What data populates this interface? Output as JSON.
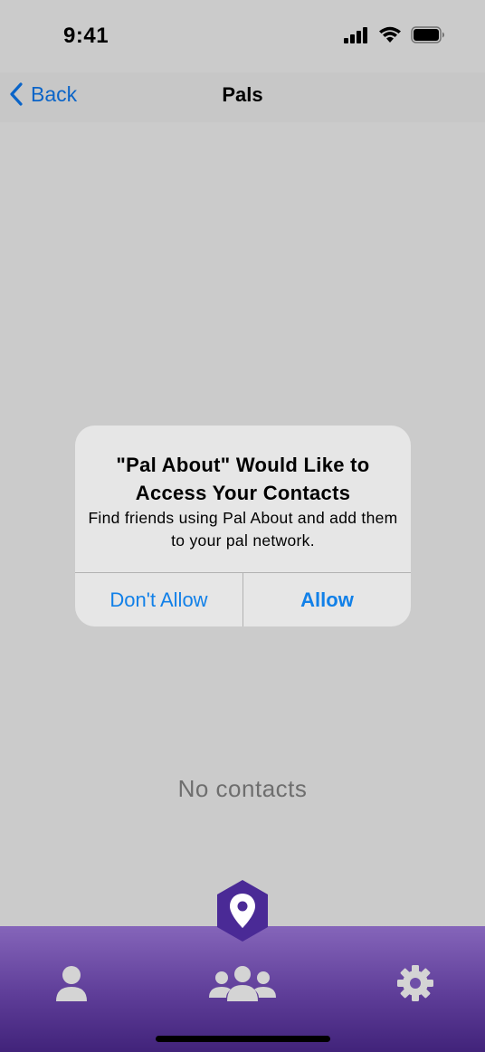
{
  "status_bar": {
    "time": "9:41"
  },
  "nav": {
    "back_label": "Back",
    "title": "Pals"
  },
  "main": {
    "empty_text": "No contacts"
  },
  "alert": {
    "title": "\"Pal About\" Would Like to Access Your Contacts",
    "message": "Find friends using Pal About and add them to your pal network.",
    "deny_label": "Don't Allow",
    "allow_label": "Allow"
  },
  "tab_bar": {
    "items": [
      {
        "icon": "person-icon"
      },
      {
        "icon": "group-icon"
      },
      {
        "icon": "gear-icon"
      }
    ],
    "center_badge_icon": "location-pin-icon"
  },
  "colors": {
    "accent_blue": "#1180e8",
    "tab_gradient_top": "#8565ba",
    "tab_gradient_bottom": "#41237a",
    "badge_purple": "#4a2a96"
  }
}
